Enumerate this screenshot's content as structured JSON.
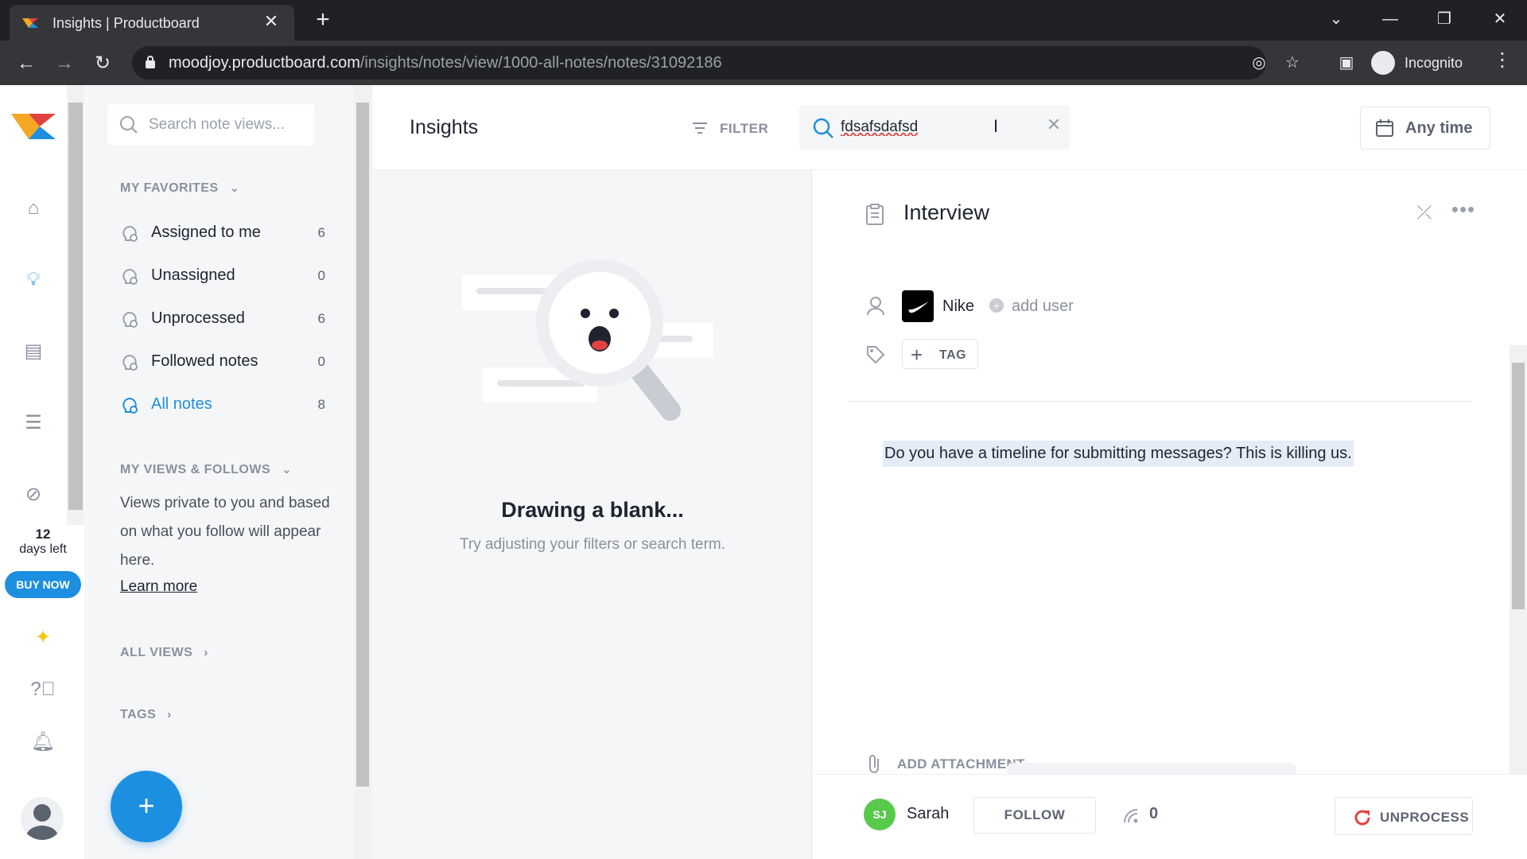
{
  "browser": {
    "tab_title": "Insights | Productboard",
    "url_domain": "moodjoy.productboard.com",
    "url_path": "/insights/notes/view/1000-all-notes/notes/31092186",
    "incognito_label": "Incognito"
  },
  "rail": {
    "trial_days": "12",
    "trial_label": "days left",
    "buy_label": "BUY NOW",
    "accent": "#1d8fe0"
  },
  "sidebar": {
    "search_placeholder": "Search note views...",
    "favorites_title": "MY FAVORITES",
    "favorites": [
      {
        "label": "Assigned to me",
        "count": "6"
      },
      {
        "label": "Unassigned",
        "count": "0"
      },
      {
        "label": "Unprocessed",
        "count": "6"
      },
      {
        "label": "Followed notes",
        "count": "0"
      },
      {
        "label": "All notes",
        "count": "8"
      }
    ],
    "views_title": "MY VIEWS & FOLLOWS",
    "views_text": "Views private to you and based on what you follow will appear here.",
    "learn_more": "Learn more",
    "all_views": "ALL VIEWS",
    "tags": "TAGS"
  },
  "header": {
    "title": "Insights",
    "filter_label": "FILTER",
    "search_value": "fdsafsdafsd",
    "anytime_label": "Any time"
  },
  "list": {
    "empty_title": "Drawing a blank...",
    "empty_subtitle": "Try adjusting your filters or search term."
  },
  "detail": {
    "title": "Interview",
    "company": "Nike",
    "add_user": "add user",
    "tag_label": "TAG",
    "note_text": "Do you have a timeline for submitting messages? This is killing us.",
    "attachment_label": "ADD ATTACHMENT",
    "owner_initials": "SJ",
    "owner_name": "Sarah",
    "follow_label": "FOLLOW",
    "followers_count": "0",
    "unprocess_label": "UNPROCESS"
  }
}
